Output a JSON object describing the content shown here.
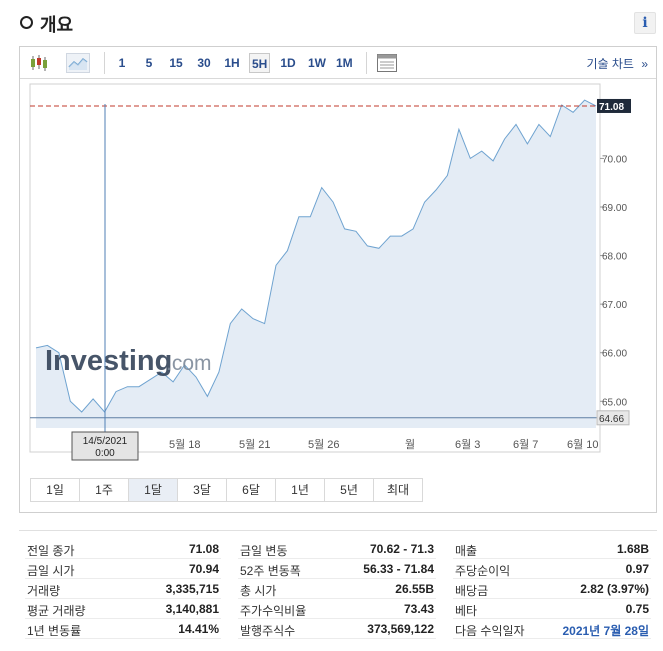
{
  "header": {
    "title": "개요",
    "info_label": "i"
  },
  "toolbar": {
    "intervals": [
      "1",
      "5",
      "15",
      "30",
      "1H",
      "5H",
      "1D",
      "1W",
      "1M"
    ],
    "active_interval": "5H",
    "technical_chart_label": "기술 차트",
    "technical_chart_arrow": "»"
  },
  "chart_data": {
    "type": "area",
    "watermark": "Investing",
    "watermark_suffix": ".com",
    "x_labels": [
      "5월 18",
      "5월 21",
      "5월 26",
      "월",
      "6월 3",
      "6월 7",
      "6월 10"
    ],
    "y_ticks": [
      65.0,
      66.0,
      67.0,
      68.0,
      69.0,
      70.0
    ],
    "ylim": [
      64.45,
      71.45
    ],
    "last_price": 71.08,
    "low_marker": 64.66,
    "crosshair_date": "14/5/2021",
    "crosshair_time": "0:00",
    "values": [
      66.1,
      66.15,
      66.0,
      65.0,
      64.78,
      65.05,
      64.78,
      65.2,
      65.3,
      65.3,
      65.45,
      65.6,
      65.4,
      65.75,
      65.5,
      65.1,
      65.6,
      66.6,
      66.9,
      66.7,
      66.6,
      67.8,
      68.1,
      68.8,
      68.8,
      69.4,
      69.1,
      68.55,
      68.5,
      68.2,
      68.15,
      68.4,
      68.4,
      68.55,
      69.1,
      69.35,
      69.65,
      70.6,
      70.0,
      70.15,
      69.95,
      70.4,
      70.7,
      70.3,
      70.7,
      70.45,
      71.1,
      70.95,
      71.2,
      71.08
    ],
    "area_color": "#e4ecf5",
    "line_color": "#6fa3d0",
    "price_line_color": "#c0392b"
  },
  "ranges": [
    "1일",
    "1주",
    "1달",
    "3달",
    "6달",
    "1년",
    "5년",
    "최대"
  ],
  "active_range": "1달",
  "stats": {
    "col1": [
      {
        "label": "전일 종가",
        "value": "71.08"
      },
      {
        "label": "금일 시가",
        "value": "70.94"
      },
      {
        "label": "거래량",
        "value": "3,335,715"
      },
      {
        "label": "평균 거래량",
        "value": "3,140,881"
      },
      {
        "label": "1년 변동률",
        "value": "14.41%"
      }
    ],
    "col2": [
      {
        "label": "금일 변동",
        "value": "70.62 - 71.3"
      },
      {
        "label": "52주 변동폭",
        "value": "56.33 - 71.84"
      },
      {
        "label": "총 시가",
        "value": "26.55B"
      },
      {
        "label": "주가수익비율",
        "value": "73.43"
      },
      {
        "label": "발행주식수",
        "value": "373,569,122"
      }
    ],
    "col3": [
      {
        "label": "매출",
        "value": "1.68B"
      },
      {
        "label": "주당순이익",
        "value": "0.97"
      },
      {
        "label": "배당금",
        "value": "2.82 (3.97%)"
      },
      {
        "label": "베타",
        "value": "0.75"
      },
      {
        "label": "다음 수익일자",
        "value": "2021년 7월 28일",
        "link": true
      }
    ]
  }
}
